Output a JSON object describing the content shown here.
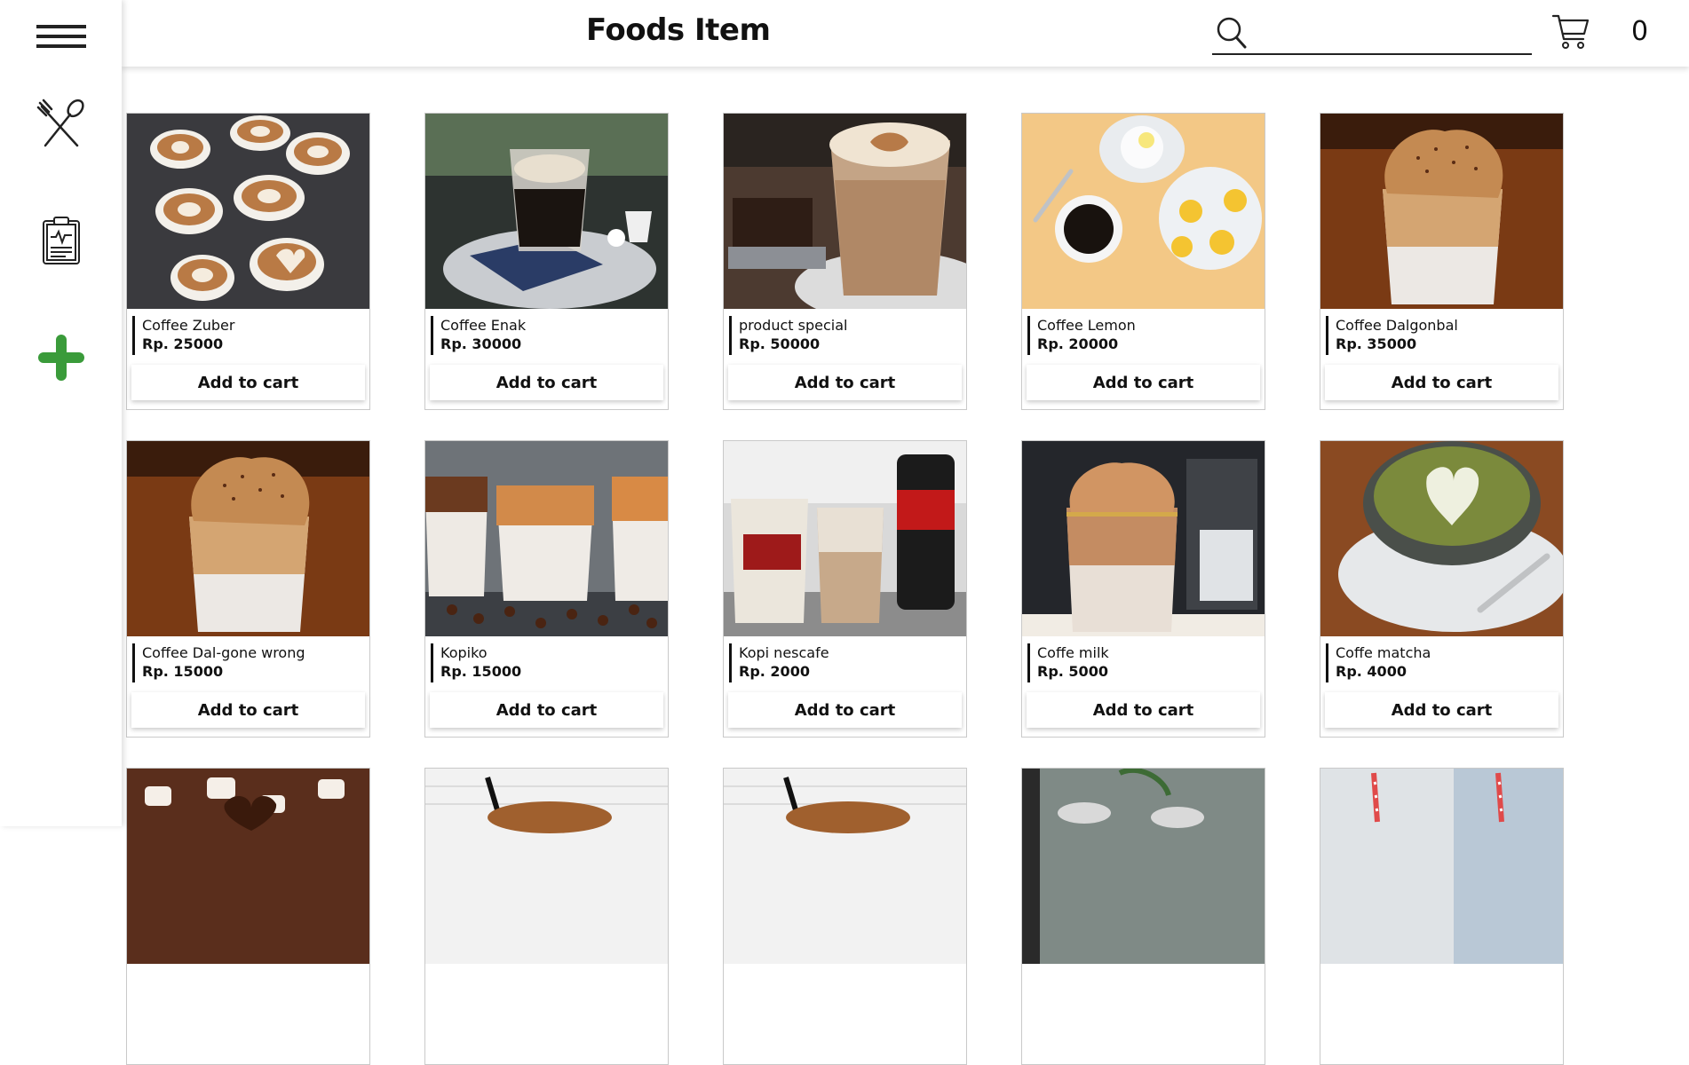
{
  "header": {
    "title": "Foods Item",
    "search_placeholder": "",
    "cart_count": "0"
  },
  "sidebar": {
    "items": [
      {
        "icon": "hamburger-menu-icon"
      },
      {
        "icon": "fork-spoon-icon"
      },
      {
        "icon": "clipboard-report-icon"
      },
      {
        "icon": "plus-icon"
      }
    ],
    "accent_color": "#3a9b3a"
  },
  "products": [
    {
      "name": "Coffee Zuber",
      "price": "Rp. 25000",
      "button": "Add to cart",
      "image": "latte-art-cups-photo"
    },
    {
      "name": "Coffee Enak",
      "price": "Rp. 30000",
      "button": "Add to cart",
      "image": "black-coffee-glass-photo"
    },
    {
      "name": "product special",
      "price": "Rp. 50000",
      "button": "Add to cart",
      "image": "latte-glass-brownie-photo"
    },
    {
      "name": "Coffee Lemon",
      "price": "Rp. 20000",
      "button": "Add to cart",
      "image": "coffee-lemon-topview-photo"
    },
    {
      "name": "Coffee Dalgonbal",
      "price": "Rp. 35000",
      "button": "Add to cart",
      "image": "dalgona-glass-photo"
    },
    {
      "name": "Coffee Dal-gone wrong",
      "price": "Rp. 15000",
      "button": "Add to cart",
      "image": "dalgona-glass-photo"
    },
    {
      "name": "Kopiko",
      "price": "Rp. 15000",
      "button": "Add to cart",
      "image": "three-dalgona-glasses-photo"
    },
    {
      "name": "Kopi nescafe",
      "price": "Rp. 2000",
      "button": "Add to cart",
      "image": "iced-coffee-nescafe-photo"
    },
    {
      "name": "Coffe milk",
      "price": "Rp. 5000",
      "button": "Add to cart",
      "image": "dalgona-milk-glass-photo"
    },
    {
      "name": "Coffe matcha",
      "price": "Rp. 4000",
      "button": "Add to cart",
      "image": "matcha-latte-photo"
    },
    {
      "name": "",
      "price": "",
      "button": "",
      "image": "chocolate-marshmallow-photo"
    },
    {
      "name": "",
      "price": "",
      "button": "",
      "image": "iced-coffee-straw-photo"
    },
    {
      "name": "",
      "price": "",
      "button": "",
      "image": "iced-coffee-straw-photo"
    },
    {
      "name": "",
      "price": "",
      "button": "",
      "image": "iced-drinks-table-photo"
    },
    {
      "name": "",
      "price": "",
      "button": "",
      "image": "striped-straw-drinks-photo"
    }
  ]
}
